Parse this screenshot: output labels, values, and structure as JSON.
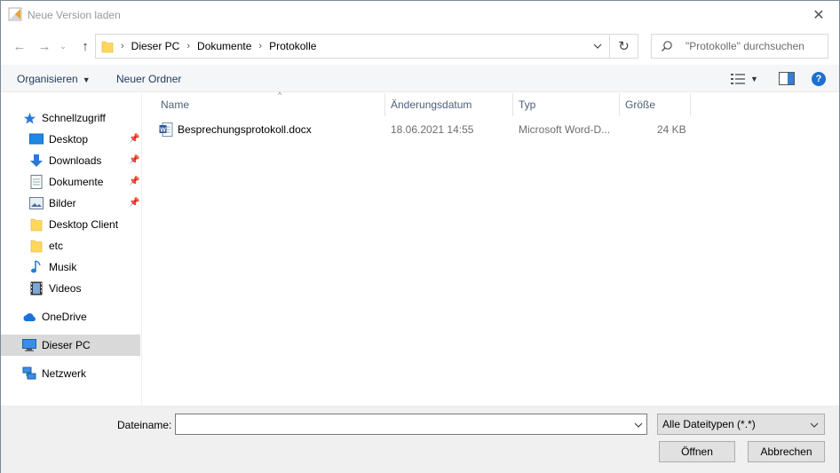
{
  "window": {
    "title": "Neue Version laden",
    "close_icon": "close-icon"
  },
  "navigation": {
    "back_icon": "arrow-left-icon",
    "forward_icon": "arrow-right-icon",
    "recent_icon": "chevron-down-icon",
    "up_icon": "arrow-up-icon"
  },
  "address": {
    "breadcrumbs": [
      "Dieser PC",
      "Dokumente",
      "Protokolle"
    ],
    "separator": "›"
  },
  "search": {
    "placeholder": "\"Protokolle\" durchsuchen"
  },
  "commandbar": {
    "organize_label": "Organisieren",
    "new_folder_label": "Neuer Ordner",
    "help_label": "?"
  },
  "sidebar": {
    "items": [
      {
        "label": "Schnellzugriff",
        "icon": "star-icon",
        "pinned": false
      },
      {
        "label": "Desktop",
        "icon": "desktop-icon",
        "pinned": true
      },
      {
        "label": "Downloads",
        "icon": "download-icon",
        "pinned": true
      },
      {
        "label": "Dokumente",
        "icon": "document-icon",
        "pinned": true
      },
      {
        "label": "Bilder",
        "icon": "picture-icon",
        "pinned": true
      },
      {
        "label": "Desktop Client",
        "icon": "folder-icon",
        "pinned": false
      },
      {
        "label": "etc",
        "icon": "folder-icon",
        "pinned": false
      },
      {
        "label": "Musik",
        "icon": "music-icon",
        "pinned": false
      },
      {
        "label": "Videos",
        "icon": "video-icon",
        "pinned": false
      },
      {
        "label": "OneDrive",
        "icon": "cloud-icon",
        "pinned": false
      },
      {
        "label": "Dieser PC",
        "icon": "computer-icon",
        "pinned": false,
        "selected": true
      },
      {
        "label": "Netzwerk",
        "icon": "network-icon",
        "pinned": false
      }
    ]
  },
  "filelist": {
    "columns": [
      "Name",
      "Änderungsdatum",
      "Typ",
      "Größe"
    ],
    "rows": [
      {
        "name": "Besprechungsprotokoll.docx",
        "modified": "18.06.2021 14:55",
        "type": "Microsoft Word-D...",
        "size": "24 KB",
        "icon": "word-document-icon"
      }
    ]
  },
  "footer": {
    "filename_label": "Dateiname:",
    "filename_value": "",
    "filetype_value": "Alle Dateitypen (*.*)",
    "open_label": "Öffnen",
    "cancel_label": "Abbrechen"
  },
  "colors": {
    "accent": "#1e6fd0",
    "folder_yellow": "#ffd75e",
    "header_text": "#4c607a",
    "selection": "#d9d9d9"
  }
}
